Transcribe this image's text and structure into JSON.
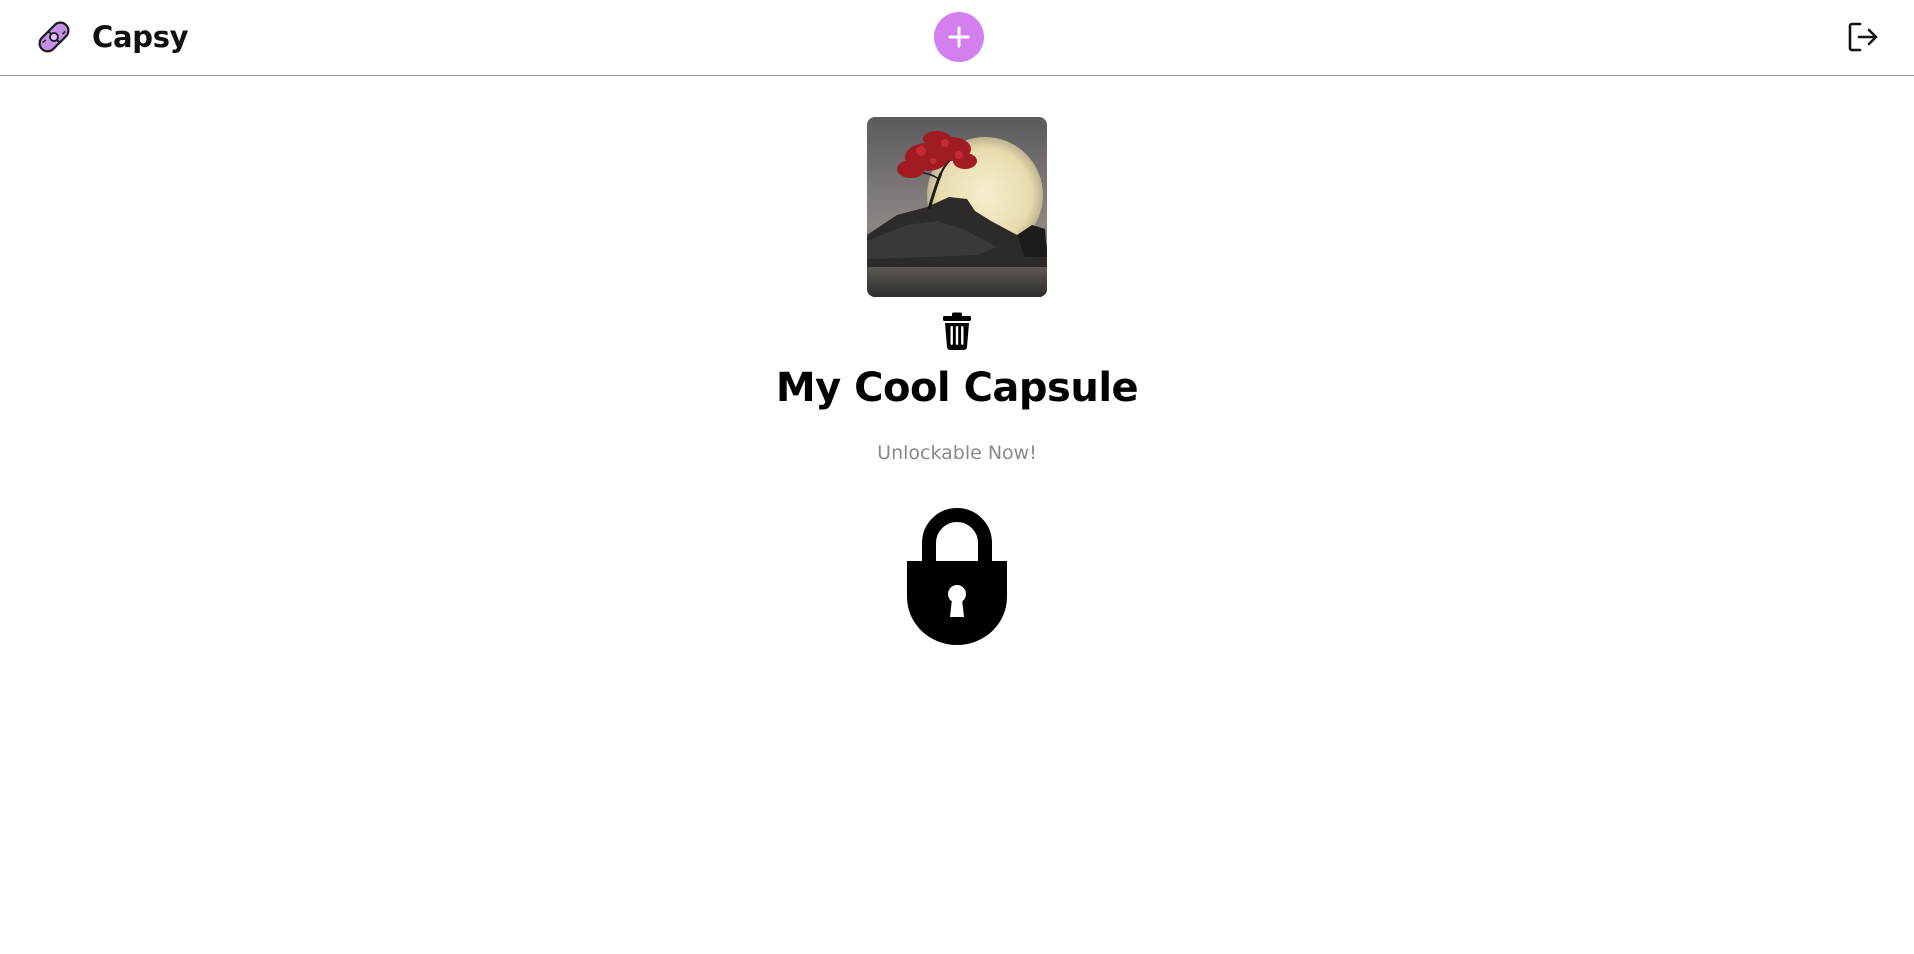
{
  "app": {
    "name": "Capsy",
    "logo_icon": "capsule-pill-icon",
    "accent_color": "#d37ff0"
  },
  "header": {
    "add_icon": "plus-icon",
    "logout_icon": "logout-icon"
  },
  "capsule": {
    "title": "My Cool Capsule",
    "status": "Unlockable Now!",
    "cover_alt": "tree-moon-artwork",
    "delete_icon": "trash-icon",
    "lock_icon": "padlock-icon"
  }
}
